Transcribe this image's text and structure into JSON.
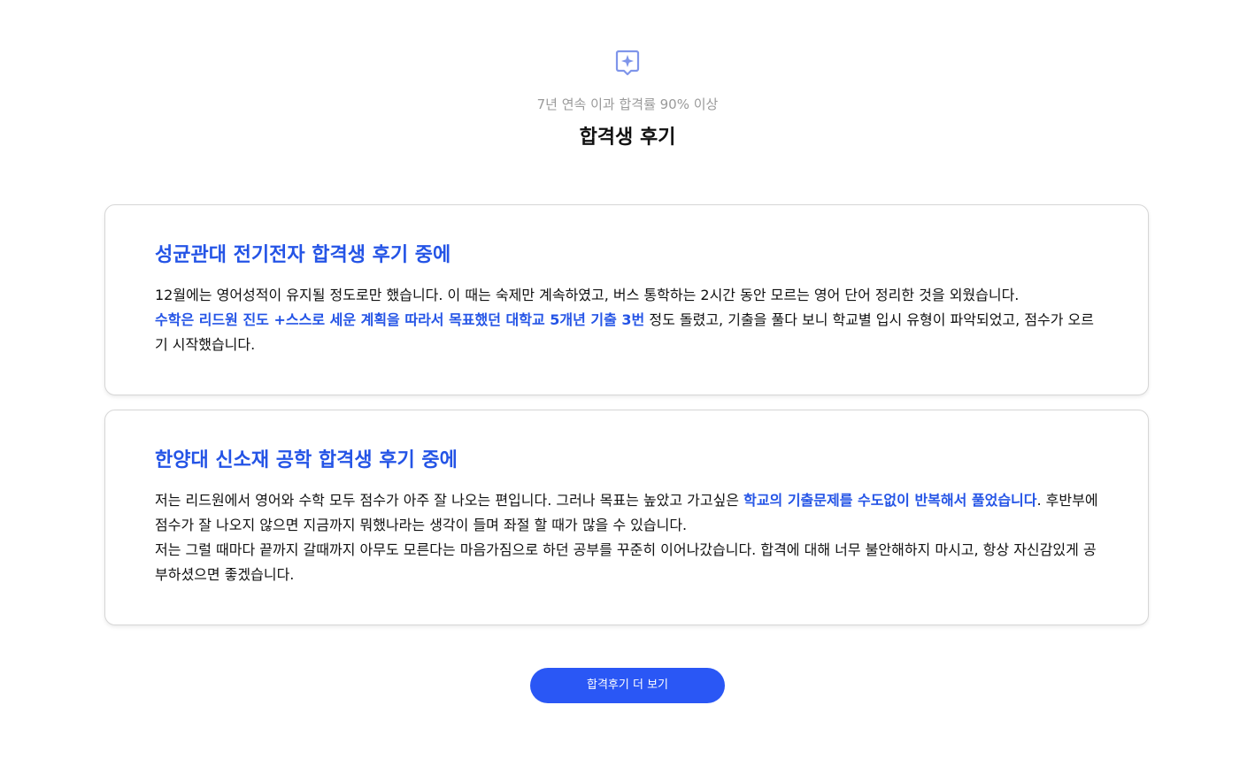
{
  "header": {
    "icon": "sparkle-badge-icon",
    "subtitle": "7년 연속 이과 합격률 90% 이상",
    "title": "합격생 후기"
  },
  "reviews": [
    {
      "title": "성균관대 전기전자 합격생 후기 중에",
      "line1": "12월에는 영어성적이 유지될 정도로만 했습니다. 이 때는 숙제만 계속하였고, 버스 통학하는 2시간 동안 모르는 영어 단어 정리한 것을 외웠습니다.",
      "highlight": "수학은 리드원 진도 +스스로 세운 계획을 따라서 목표했던 대학교 5개년 기출 3번",
      "line2_rest": " 정도 돌렸고, 기출을 풀다 보니 학교별 입시 유형이 파악되었고, 점수가 오르기 시작했습니다."
    },
    {
      "title": "한양대 신소재 공학 합격생 후기 중에",
      "line1_start": "저는 리드원에서 영어와 수학 모두 점수가 아주 잘 나오는 편입니다. 그러나 목표는 높았고 가고싶은 ",
      "highlight": "학교의 기출문제를 수도없이 반복해서 풀었습니다",
      "line1_rest": ". 후반부에 점수가 잘 나오지 않으면 지금까지 뭐했나라는 생각이 들며 좌절 할 때가 많을 수 있습니다.",
      "line2": "저는 그럴 때마다 끝까지 갈때까지 아무도 모른다는 마음가짐으로 하던 공부를 꾸준히 이어나갔습니다. 합격에 대해 너무 불안해하지 마시고, 항상 자신감있게 공부하셨으면 좋겠습니다."
    }
  ],
  "more_button": {
    "label": "합격후기 더 보기"
  },
  "colors": {
    "accent": "#2454e6",
    "button": "#2a57f5",
    "subtitle": "#9a9a9a",
    "icon": "#7f95ea"
  }
}
